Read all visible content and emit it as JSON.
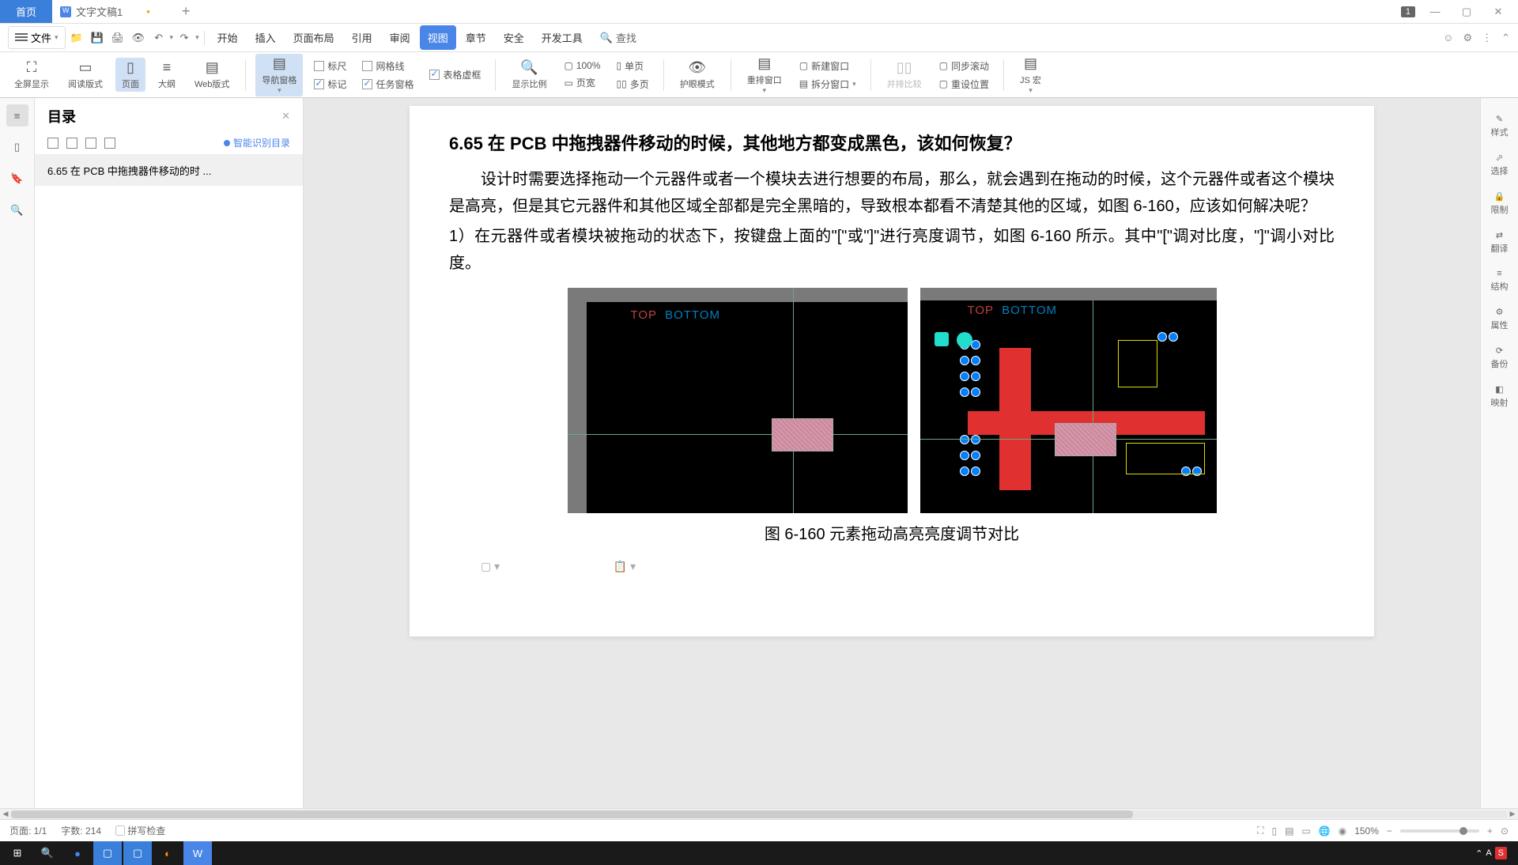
{
  "tabs": {
    "home": "首页",
    "doc": "文字文稿1"
  },
  "titlebar_num": "1",
  "menu": {
    "file": "文件",
    "items": [
      "开始",
      "插入",
      "页面布局",
      "引用",
      "审阅",
      "视图",
      "章节",
      "安全",
      "开发工具"
    ],
    "search": "查找"
  },
  "ribbon": {
    "fullscreen": "全屏显示",
    "read_mode": "阅读版式",
    "page_mode": "页面",
    "outline": "大纲",
    "web_mode": "Web版式",
    "nav_pane": "导航窗格",
    "ruler": "标尺",
    "gridlines": "网格线",
    "markup": "标记",
    "task_pane": "任务窗格",
    "table_dashes": "表格虚框",
    "zoom_ratio": "显示比例",
    "percent100": "100%",
    "single_page": "单页",
    "page_width": "页宽",
    "multi_page": "多页",
    "eye_care": "护眼模式",
    "rearrange": "重排窗口",
    "new_window": "新建窗口",
    "split_window": "拆分窗口",
    "side_by_side": "并排比较",
    "sync_scroll": "同步滚动",
    "reset_pos": "重设位置",
    "js_macro": "JS 宏"
  },
  "sidebar": {
    "title": "目录",
    "smart": "智能识别目录",
    "toc_item": "6.65   在 PCB 中拖拽器件移动的时 ..."
  },
  "doc": {
    "heading": "6.65    在 PCB 中拖拽器件移动的时候，其他地方都变成黑色，该如何恢复？",
    "p1": "设计时需要选择拖动一个元器件或者一个模块去进行想要的布局，那么，就会遇到在拖动的时候，这个元器件或者这个模块是高亮，但是其它元器件和其他区域全部都是完全黑暗的，导致根本都看不清楚其他的区域，如图 6-160，应该如何解决呢？",
    "p2": "1）在元器件或者模块被拖动的状态下，按键盘上面的\"[\"或\"]\"进行亮度调节，如图 6-160 所示。其中\"[\"调对比度，\"]\"调小对比度。",
    "caption": "图 6-160 元素拖动高亮亮度调节对比",
    "layer_top": "TOP",
    "layer_bottom": "BOTTOM"
  },
  "right_rail": {
    "style": "样式",
    "select": "选择",
    "restrict": "限制",
    "translate": "翻译",
    "structure": "结构",
    "properties": "属性",
    "backup": "备份",
    "mapping": "映射"
  },
  "statusbar": {
    "page": "页面: 1/1",
    "words": "字数: 214",
    "spellcheck": "拼写检查",
    "zoom": "150%"
  }
}
